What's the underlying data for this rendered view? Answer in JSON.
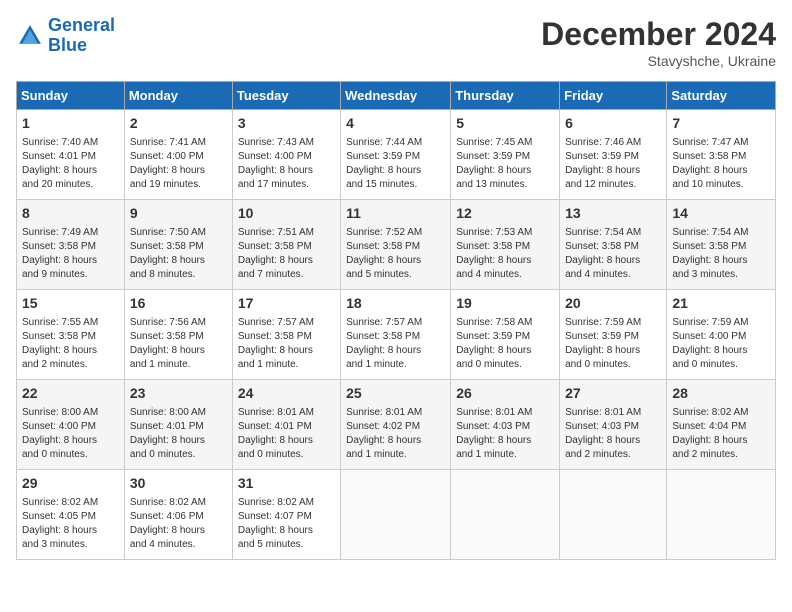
{
  "header": {
    "logo_line1": "General",
    "logo_line2": "Blue",
    "month_title": "December 2024",
    "subtitle": "Stavyshche, Ukraine"
  },
  "days_of_week": [
    "Sunday",
    "Monday",
    "Tuesday",
    "Wednesday",
    "Thursday",
    "Friday",
    "Saturday"
  ],
  "weeks": [
    [
      {
        "num": "1",
        "info": "Sunrise: 7:40 AM\nSunset: 4:01 PM\nDaylight: 8 hours\nand 20 minutes."
      },
      {
        "num": "2",
        "info": "Sunrise: 7:41 AM\nSunset: 4:00 PM\nDaylight: 8 hours\nand 19 minutes."
      },
      {
        "num": "3",
        "info": "Sunrise: 7:43 AM\nSunset: 4:00 PM\nDaylight: 8 hours\nand 17 minutes."
      },
      {
        "num": "4",
        "info": "Sunrise: 7:44 AM\nSunset: 3:59 PM\nDaylight: 8 hours\nand 15 minutes."
      },
      {
        "num": "5",
        "info": "Sunrise: 7:45 AM\nSunset: 3:59 PM\nDaylight: 8 hours\nand 13 minutes."
      },
      {
        "num": "6",
        "info": "Sunrise: 7:46 AM\nSunset: 3:59 PM\nDaylight: 8 hours\nand 12 minutes."
      },
      {
        "num": "7",
        "info": "Sunrise: 7:47 AM\nSunset: 3:58 PM\nDaylight: 8 hours\nand 10 minutes."
      }
    ],
    [
      {
        "num": "8",
        "info": "Sunrise: 7:49 AM\nSunset: 3:58 PM\nDaylight: 8 hours\nand 9 minutes."
      },
      {
        "num": "9",
        "info": "Sunrise: 7:50 AM\nSunset: 3:58 PM\nDaylight: 8 hours\nand 8 minutes."
      },
      {
        "num": "10",
        "info": "Sunrise: 7:51 AM\nSunset: 3:58 PM\nDaylight: 8 hours\nand 7 minutes."
      },
      {
        "num": "11",
        "info": "Sunrise: 7:52 AM\nSunset: 3:58 PM\nDaylight: 8 hours\nand 5 minutes."
      },
      {
        "num": "12",
        "info": "Sunrise: 7:53 AM\nSunset: 3:58 PM\nDaylight: 8 hours\nand 4 minutes."
      },
      {
        "num": "13",
        "info": "Sunrise: 7:54 AM\nSunset: 3:58 PM\nDaylight: 8 hours\nand 4 minutes."
      },
      {
        "num": "14",
        "info": "Sunrise: 7:54 AM\nSunset: 3:58 PM\nDaylight: 8 hours\nand 3 minutes."
      }
    ],
    [
      {
        "num": "15",
        "info": "Sunrise: 7:55 AM\nSunset: 3:58 PM\nDaylight: 8 hours\nand 2 minutes."
      },
      {
        "num": "16",
        "info": "Sunrise: 7:56 AM\nSunset: 3:58 PM\nDaylight: 8 hours\nand 1 minute."
      },
      {
        "num": "17",
        "info": "Sunrise: 7:57 AM\nSunset: 3:58 PM\nDaylight: 8 hours\nand 1 minute."
      },
      {
        "num": "18",
        "info": "Sunrise: 7:57 AM\nSunset: 3:58 PM\nDaylight: 8 hours\nand 1 minute."
      },
      {
        "num": "19",
        "info": "Sunrise: 7:58 AM\nSunset: 3:59 PM\nDaylight: 8 hours\nand 0 minutes."
      },
      {
        "num": "20",
        "info": "Sunrise: 7:59 AM\nSunset: 3:59 PM\nDaylight: 8 hours\nand 0 minutes."
      },
      {
        "num": "21",
        "info": "Sunrise: 7:59 AM\nSunset: 4:00 PM\nDaylight: 8 hours\nand 0 minutes."
      }
    ],
    [
      {
        "num": "22",
        "info": "Sunrise: 8:00 AM\nSunset: 4:00 PM\nDaylight: 8 hours\nand 0 minutes."
      },
      {
        "num": "23",
        "info": "Sunrise: 8:00 AM\nSunset: 4:01 PM\nDaylight: 8 hours\nand 0 minutes."
      },
      {
        "num": "24",
        "info": "Sunrise: 8:01 AM\nSunset: 4:01 PM\nDaylight: 8 hours\nand 0 minutes."
      },
      {
        "num": "25",
        "info": "Sunrise: 8:01 AM\nSunset: 4:02 PM\nDaylight: 8 hours\nand 1 minute."
      },
      {
        "num": "26",
        "info": "Sunrise: 8:01 AM\nSunset: 4:03 PM\nDaylight: 8 hours\nand 1 minute."
      },
      {
        "num": "27",
        "info": "Sunrise: 8:01 AM\nSunset: 4:03 PM\nDaylight: 8 hours\nand 2 minutes."
      },
      {
        "num": "28",
        "info": "Sunrise: 8:02 AM\nSunset: 4:04 PM\nDaylight: 8 hours\nand 2 minutes."
      }
    ],
    [
      {
        "num": "29",
        "info": "Sunrise: 8:02 AM\nSunset: 4:05 PM\nDaylight: 8 hours\nand 3 minutes."
      },
      {
        "num": "30",
        "info": "Sunrise: 8:02 AM\nSunset: 4:06 PM\nDaylight: 8 hours\nand 4 minutes."
      },
      {
        "num": "31",
        "info": "Sunrise: 8:02 AM\nSunset: 4:07 PM\nDaylight: 8 hours\nand 5 minutes."
      },
      null,
      null,
      null,
      null
    ]
  ]
}
